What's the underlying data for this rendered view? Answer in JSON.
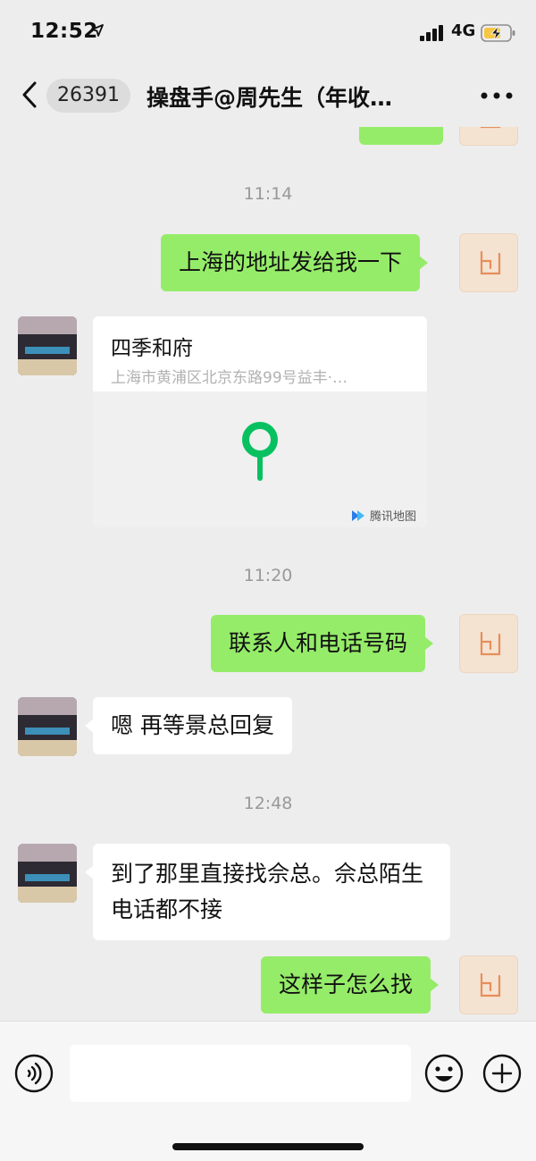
{
  "status_bar": {
    "time": "12:52",
    "network": "4G"
  },
  "nav": {
    "unread_count": "26391",
    "title": "操盘手@周先生（年收…"
  },
  "messages": [
    {
      "kind": "timestamp",
      "text": "11:14"
    },
    {
      "kind": "text",
      "side": "right",
      "text": "上海的地址发给我一下"
    },
    {
      "kind": "location",
      "side": "left",
      "name": "四季和府",
      "address": "上海市黄浦区北京东路99号益丰·…",
      "provider": "腾讯地图"
    },
    {
      "kind": "timestamp",
      "text": "11:20"
    },
    {
      "kind": "text",
      "side": "right",
      "text": "联系人和电话号码"
    },
    {
      "kind": "text",
      "side": "left",
      "text": "嗯 再等景总回复"
    },
    {
      "kind": "timestamp",
      "text": "12:48"
    },
    {
      "kind": "text",
      "side": "left",
      "text": "到了那里直接找佘总。佘总陌生电话都不接"
    },
    {
      "kind": "text",
      "side": "right",
      "text": "这样子怎么找"
    }
  ],
  "colors": {
    "background": "#ededed",
    "sent_bubble": "#95ec69",
    "received_bubble": "#ffffff",
    "map_pin": "#07c160",
    "timestamp_text": "#999999"
  },
  "icons": [
    "location-arrow-icon",
    "signal-bars-icon",
    "battery-charging-icon",
    "back-chevron-icon",
    "more-dots-icon",
    "map-pin-icon",
    "tencent-map-logo-icon",
    "voice-icon",
    "emoji-icon",
    "plus-icon"
  ]
}
